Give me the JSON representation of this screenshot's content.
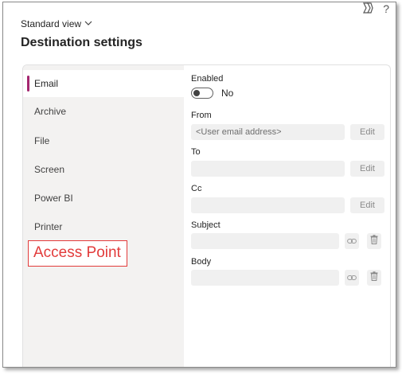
{
  "header": {
    "view_label": "Standard view",
    "title": "Destination settings",
    "icons": [
      "copilot-icon",
      "help-icon"
    ],
    "help_glyph": "?"
  },
  "nav": {
    "items": [
      {
        "label": "Email",
        "selected": true
      },
      {
        "label": "Archive",
        "selected": false
      },
      {
        "label": "File",
        "selected": false
      },
      {
        "label": "Screen",
        "selected": false
      },
      {
        "label": "Power BI",
        "selected": false
      },
      {
        "label": "Printer",
        "selected": false
      }
    ],
    "annotation": "Access Point"
  },
  "form": {
    "enabled_label": "Enabled",
    "toggle_text": "No",
    "toggle_on": false,
    "from_label": "From",
    "from_placeholder": "<User email address>",
    "to_label": "To",
    "cc_label": "Cc",
    "subject_label": "Subject",
    "body_label": "Body",
    "edit_label": "Edit"
  },
  "colors": {
    "accent": "#a4276f",
    "annotation": "#e23b3b",
    "nav_bg": "#f3f2f1",
    "field_bg": "#f0f0f0"
  }
}
